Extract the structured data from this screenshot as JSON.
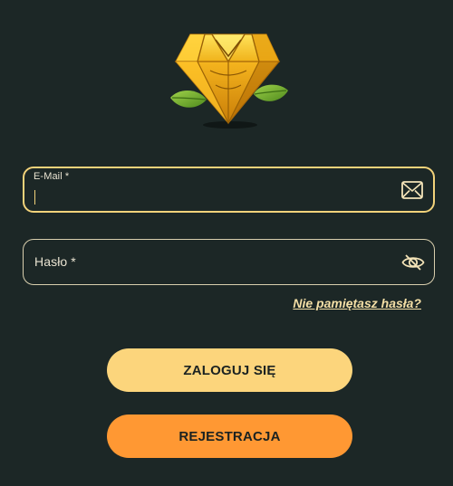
{
  "logo": {
    "icon": "diamond-with-leaves-icon"
  },
  "email_field": {
    "label": "E-Mail *",
    "value": "",
    "icon": "envelope-icon"
  },
  "password_field": {
    "label": "Hasło *",
    "value": "",
    "icon": "eye-icon"
  },
  "forgot_password": {
    "label": "Nie pamiętasz hasła?"
  },
  "buttons": {
    "login_label": "ZALOGUJ SIĘ",
    "register_label": "REJESTRACJA"
  },
  "colors": {
    "background": "#1c2726",
    "accent": "#f2d27a",
    "login_button": "#fcd57c",
    "register_button": "#ff9833"
  }
}
